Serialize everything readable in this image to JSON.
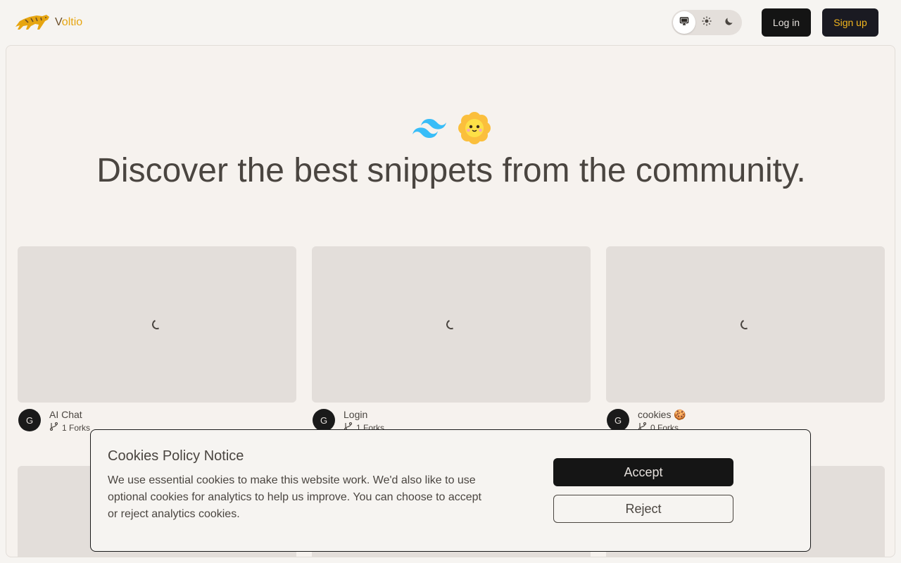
{
  "header": {
    "logo_text_first": "V",
    "logo_text_rest": "oltio",
    "login_label": "Log in",
    "signup_label": "Sign up",
    "theme_options": [
      "system",
      "light",
      "dark"
    ],
    "theme_selected": "system"
  },
  "hero": {
    "title": "Discover the best snippets from the community.",
    "icons": [
      "tailwind-icon",
      "flower-emoji-icon"
    ]
  },
  "cards": [
    {
      "author_initial": "G",
      "title": "AI Chat",
      "forks": "1 Forks"
    },
    {
      "author_initial": "G",
      "title": "Login",
      "forks": "1 Forks"
    },
    {
      "author_initial": "G",
      "title": "cookies 🍪",
      "forks": "0 Forks"
    }
  ],
  "cookie_banner": {
    "title": "Cookies Policy Notice",
    "text": "We use essential cookies to make this website work. We'd also like to use optional cookies for analytics to help us improve. You can choose to accept or reject analytics cookies.",
    "accept_label": "Accept",
    "reject_label": "Reject"
  },
  "colors": {
    "background": "#f6f4f1",
    "accent": "#e6a511",
    "dark_button": "#141414",
    "placeholder": "#e3deda"
  }
}
